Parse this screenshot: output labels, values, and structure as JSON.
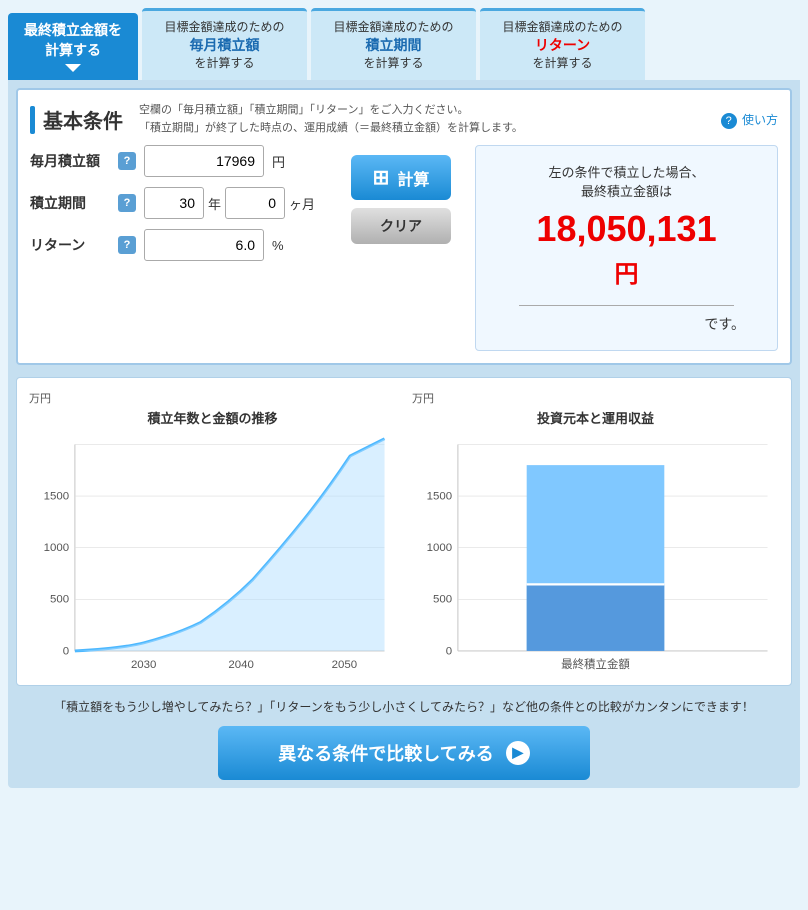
{
  "tabs": {
    "active": {
      "line1": "最終積立金額を",
      "line2": "計算する"
    },
    "tab2": {
      "prefix": "目標金額達成のための",
      "highlight": "毎月積立額",
      "suffix": "を計算する"
    },
    "tab3": {
      "prefix": "目標金額達成のための",
      "highlight": "積立期間",
      "suffix": "を計算する"
    },
    "tab4": {
      "prefix": "目標金額達成のための",
      "highlight": "リターン",
      "suffix": "を計算する"
    }
  },
  "section": {
    "title": "基本条件",
    "description_line1": "空欄の「毎月積立額」「積立期間」「リターン」をご入力ください。",
    "description_line2": "「積立期間」が終了した時点の、運用成績（＝最終積立金額）を計算します。",
    "help_label": "使い方"
  },
  "form": {
    "monthly_label": "毎月積立額",
    "monthly_value": "17969",
    "monthly_unit": "円",
    "period_label": "積立期間",
    "period_years": "30",
    "period_months": "0",
    "period_year_unit": "年",
    "period_month_unit": "ヶ月",
    "return_label": "リターン",
    "return_value": "6.0",
    "return_unit": "%"
  },
  "buttons": {
    "calc_label": "計算",
    "clear_label": "クリア"
  },
  "result": {
    "description": "左の条件で積立した場合、\n最終積立金額は",
    "amount": "18,050,131",
    "unit": "円",
    "desu": "です。"
  },
  "charts": {
    "chart1": {
      "title": "積立年数と金額の推移",
      "unit": "万円",
      "x_labels": [
        "2030",
        "2040",
        "2050"
      ],
      "y_labels": [
        "0",
        "500",
        "1000",
        "1500"
      ]
    },
    "chart2": {
      "title": "投資元本と運用収益",
      "unit": "万円",
      "x_labels": [
        "最終積立金額"
      ],
      "y_labels": [
        "0",
        "500",
        "1000",
        "1500"
      ],
      "bar_total": 1805,
      "bar_principal": 647
    }
  },
  "bottom": {
    "text": "「積立額をもう少し増やしてみたら？」「リターンをもう少し小さくしてみたら？」など他の条件との比較がカンタンにできます！",
    "compare_button_label": "異なる条件で比較してみる"
  }
}
